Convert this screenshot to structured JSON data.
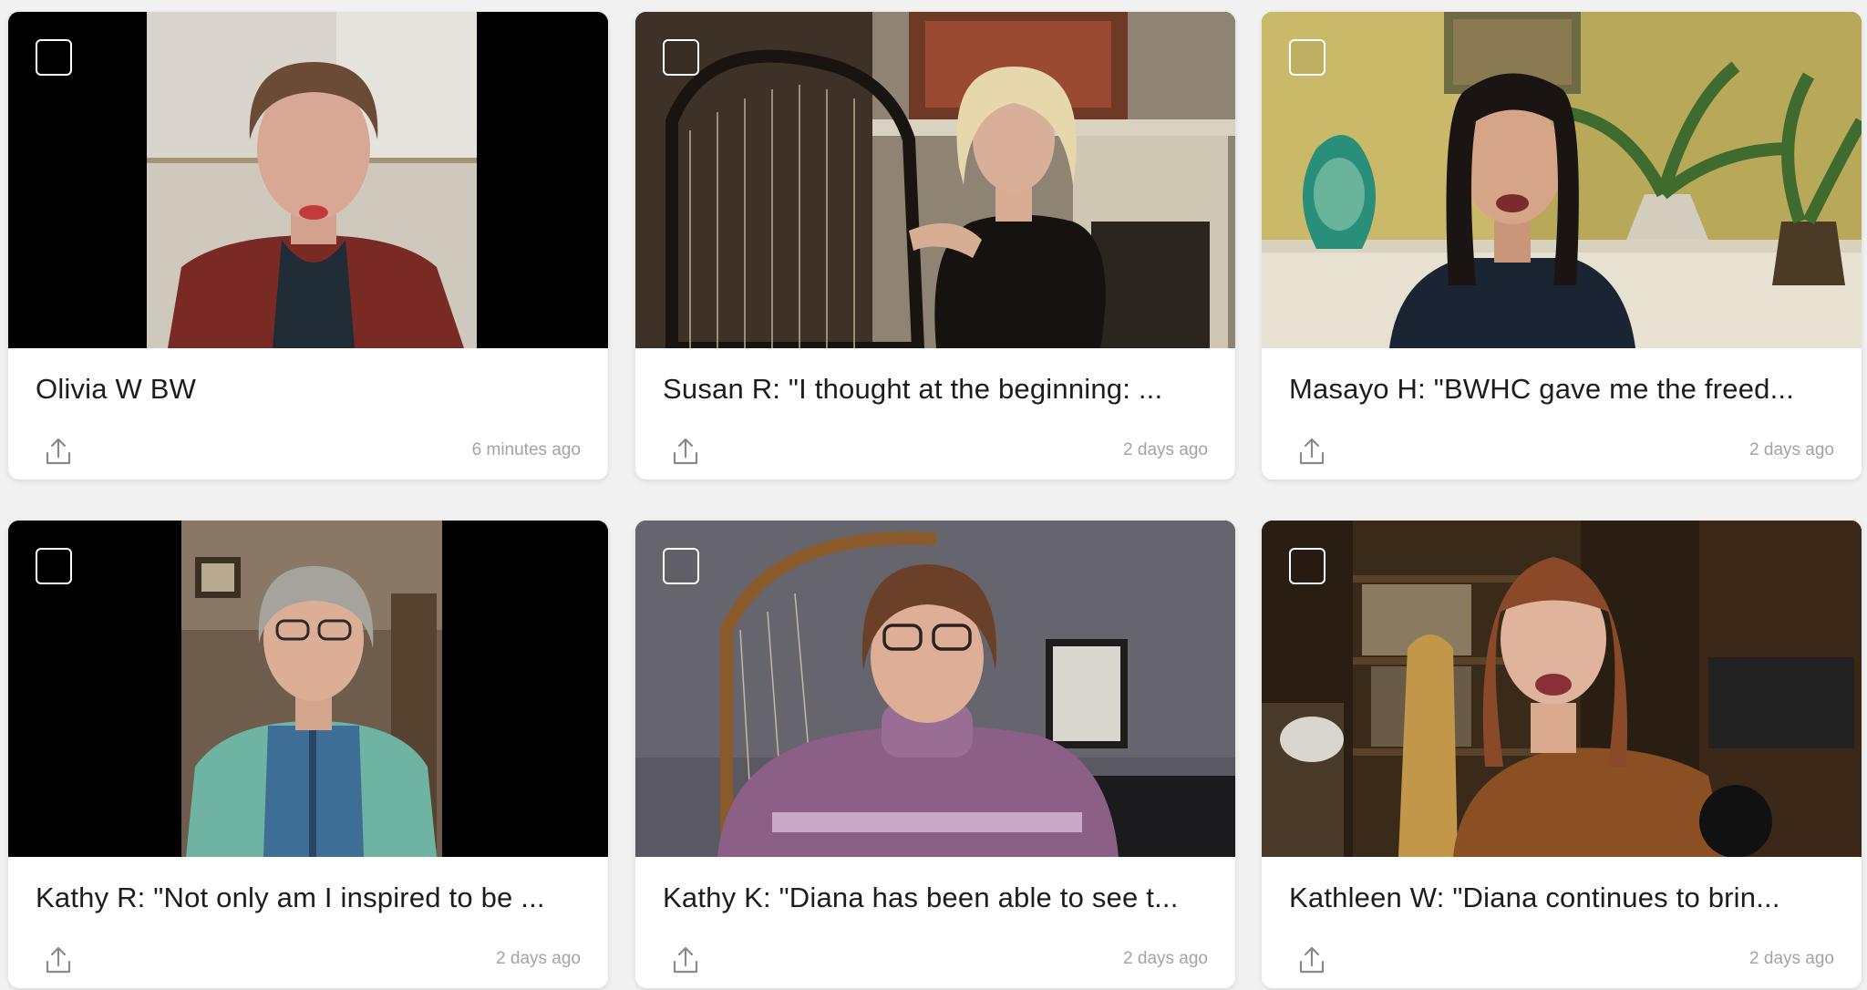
{
  "cards": [
    {
      "title": "Olivia W BW",
      "time": "6 minutes ago"
    },
    {
      "title": "Susan R: \"I thought at the beginning: ...",
      "time": "2 days ago"
    },
    {
      "title": "Masayo H: \"BWHC gave me the freed...",
      "time": "2 days ago"
    },
    {
      "title": "Kathy R: \"Not only am I inspired to be ...",
      "time": "2 days ago"
    },
    {
      "title": "Kathy K: \"Diana has been able to see t...",
      "time": "2 days ago"
    },
    {
      "title": "Kathleen W: \"Diana continues to brin...",
      "time": "2 days ago"
    }
  ],
  "icons": {
    "select": "checkbox-icon",
    "share": "share-upload-icon"
  },
  "colors": {
    "background": "#f1f1f1",
    "card": "#ffffff",
    "title": "#1d1d1f",
    "timestamp": "#a3a3a3"
  }
}
